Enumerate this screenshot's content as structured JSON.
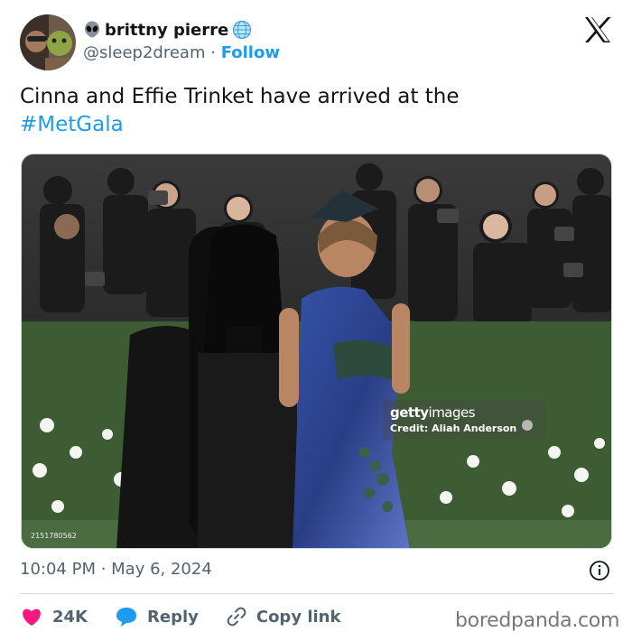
{
  "user": {
    "display_name": "brittny pierre",
    "handle": "@sleep2dream",
    "separator": "·",
    "follow_label": "Follow"
  },
  "tweet": {
    "text_prefix": "Cinna and Effie Trinket have arrived at the",
    "hashtag": "#MetGala"
  },
  "media": {
    "getty_logo_bold": "getty",
    "getty_logo_thin": "images",
    "credit": "Credit: Aliah Anderson",
    "photo_id": "2151780562"
  },
  "meta": {
    "timestamp": "10:04 PM · May 6, 2024"
  },
  "actions": {
    "likes": "24K",
    "reply_label": "Reply",
    "copy_link_label": "Copy link"
  },
  "watermark": "boredpanda.com",
  "colors": {
    "link": "#1d9bf0",
    "text": "#0f1419",
    "muted": "#536471",
    "like": "#f91880"
  },
  "icons": {
    "platform": "x-logo-icon",
    "info": "info-icon",
    "like": "heart-icon",
    "reply": "reply-bubble-icon",
    "copy_link": "link-icon"
  }
}
